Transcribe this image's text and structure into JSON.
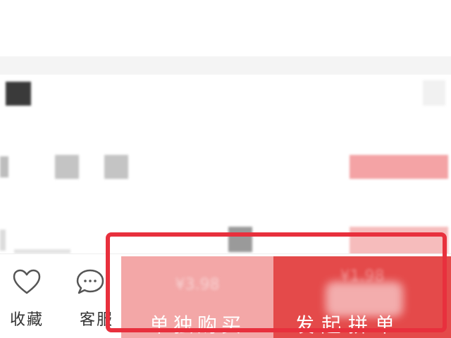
{
  "bottom_bar": {
    "favorite": {
      "label": "收藏",
      "icon": "heart-icon"
    },
    "service": {
      "label": "客服",
      "icon": "chat-bubble-icon"
    },
    "solo_buy": {
      "price": "¥3.98",
      "label": "单独购买"
    },
    "group_buy": {
      "price": "¥1.98",
      "label": "发起拼单"
    }
  },
  "colors": {
    "solo_buy_bg": "#f3a7a7",
    "group_buy_bg": "#e44a4a",
    "highlight": "#e8303d"
  }
}
